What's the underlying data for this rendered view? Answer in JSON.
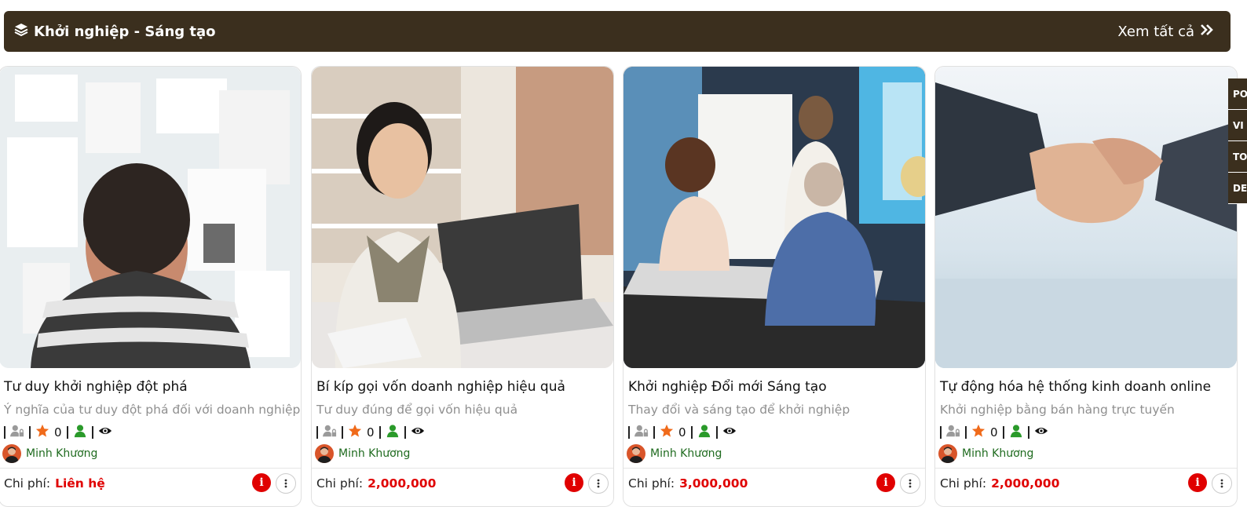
{
  "header": {
    "title": "Khởi nghiệp - Sáng tạo",
    "see_all": "Xem tất cả",
    "colors": {
      "bar": "#3b2f1e",
      "text": "#ffffff"
    }
  },
  "cards": [
    {
      "title": "Tư duy khởi nghiệp đột phá",
      "subtitle": "Ý nghĩa của tư duy đột phá đối với doanh nghiệp",
      "rating": "0",
      "author": "Minh Khương",
      "cost_label": "Chi phí:",
      "price": "Liên hệ"
    },
    {
      "title": "Bí kíp gọi vốn doanh nghiệp hiệu quả",
      "subtitle": "Tư duy đúng để gọi vốn hiệu quả",
      "rating": "0",
      "author": "Minh Khương",
      "cost_label": "Chi phí:",
      "price": "2,000,000"
    },
    {
      "title": "Khởi nghiệp Đổi mới Sáng tạo",
      "subtitle": "Thay đổi và sáng tạo để khởi nghiệp",
      "rating": "0",
      "author": "Minh Khương",
      "cost_label": "Chi phí:",
      "price": "3,000,000"
    },
    {
      "title": "Tự động hóa hệ thống kinh doanh online",
      "subtitle": "Khởi nghiệp bằng bán hàng trực tuyến",
      "rating": "0",
      "author": "Minh Khương",
      "cost_label": "Chi phí:",
      "price": "2,000,000"
    }
  ],
  "side_tabs": [
    "PO",
    "VI",
    "TO",
    "DE"
  ],
  "icons": {
    "layers": "layers-icon",
    "chevrons": "double-chevron-right-icon",
    "locked_user": "user-lock-icon",
    "star": "star-icon",
    "user": "user-icon",
    "eye": "eye-icon",
    "info": "info-icon",
    "more": "more-vertical-icon"
  }
}
